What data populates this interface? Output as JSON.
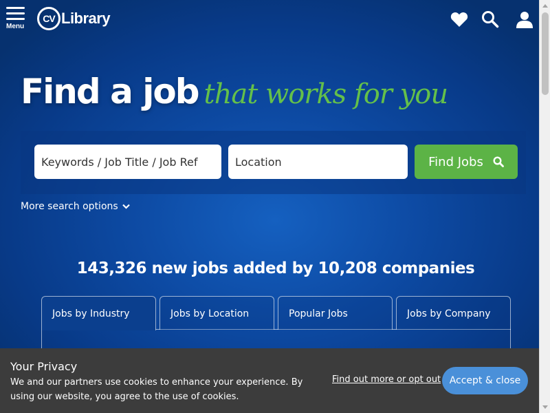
{
  "header": {
    "menu_label": "Menu",
    "logo_cv": "CV",
    "logo_text": "Library",
    "icons": [
      "heart-icon",
      "search-icon",
      "user-icon"
    ]
  },
  "hero": {
    "title_main": "Find a job",
    "title_accent": "that works for you"
  },
  "search": {
    "keywords_placeholder": "Keywords / Job Title / Job Ref",
    "location_placeholder": "Location",
    "find_button": "Find Jobs",
    "more_options": "More search options"
  },
  "stats": {
    "text": "143,326 new jobs added by 10,208 companies"
  },
  "tabs": [
    {
      "label": "Jobs by Industry",
      "active": true
    },
    {
      "label": "Jobs by Location",
      "active": false
    },
    {
      "label": "Popular Jobs",
      "active": false
    },
    {
      "label": "Jobs by Company",
      "active": false
    }
  ],
  "colors": {
    "brand_blue": "#0d4aa3",
    "accent_green": "#64c04a",
    "button_green": "#5cb346",
    "cookie_bg": "#3c3c3c",
    "cookie_button": "#4a90d9"
  },
  "cookie": {
    "title": "Your Privacy",
    "text": "We and our partners use cookies to enhance your experience. By using our website, you agree to the use of cookies.",
    "link": "Find out more or opt out",
    "button": "Accept & close"
  }
}
